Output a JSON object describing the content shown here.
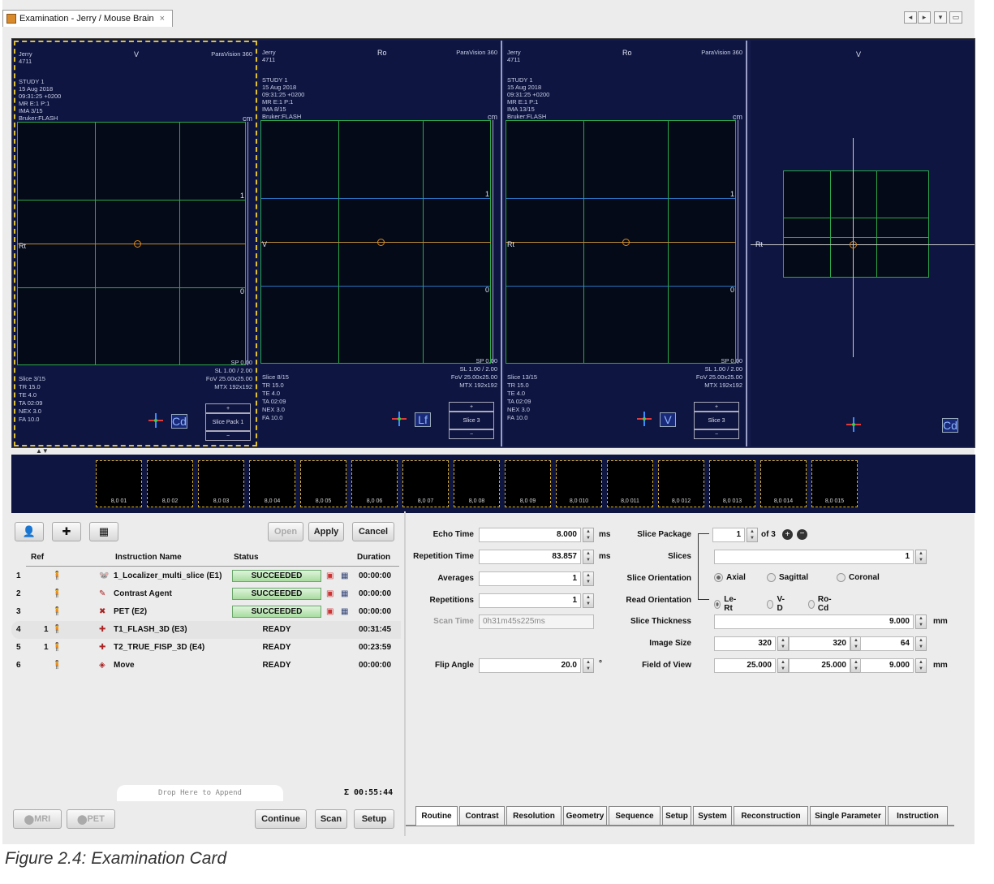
{
  "window": {
    "tab_title": "Examination - Jerry / Mouse Brain",
    "tab_close": "×"
  },
  "title_buttons": [
    "◂",
    "▸",
    "▾",
    "▭"
  ],
  "viewports": [
    {
      "orientation": "V",
      "software": "ParaVision 360",
      "patient": "Jerry",
      "id": "4711",
      "study": "STUDY 1",
      "date": "15 Aug 2018",
      "time": "09:31:25 +0200",
      "series": "MR E:1 P:1",
      "image": "IMA 3/15",
      "seq": "Bruker:FLASH",
      "unit": "cm",
      "tick_top": "1",
      "tick_bot": "0",
      "left_label": "Rt",
      "sp": "SP 0.00",
      "sl": "SL 1.00 / 2.00",
      "fov": "FoV 25.00x25.00",
      "mtx": "MTX 192x192",
      "slice": "Slice 3/15",
      "tr": "TR 15.0",
      "te": "TE 4.0",
      "ta": "TA 02:09",
      "nex": "NEX 3.0",
      "fa": "FA 10.0",
      "badge": "Cd",
      "pack": "Slice Pack 1",
      "plus": "+",
      "minus": "−"
    },
    {
      "orientation": "Ro",
      "software": "ParaVision 360",
      "patient": "Jerry",
      "id": "4711",
      "study": "STUDY 1",
      "date": "15 Aug 2018",
      "time": "09:31:25 +0200",
      "series": "MR E:1 P:1",
      "image": "IMA 8/15",
      "seq": "Bruker:FLASH",
      "unit": "cm",
      "tick_top": "1",
      "tick_bot": "0",
      "left_label": "V",
      "sp": "SP 0.00",
      "sl": "SL 1.00 / 2.00",
      "fov": "FoV 25.00x25.00",
      "mtx": "MTX 192x192",
      "slice": "Slice 8/15",
      "tr": "TR 15.0",
      "te": "TE 4.0",
      "ta": "TA 02:09",
      "nex": "NEX 3.0",
      "fa": "FA 10.0",
      "badge": "Lf",
      "pack": "Slice 3",
      "plus": "+",
      "minus": "−"
    },
    {
      "orientation": "Ro",
      "software": "ParaVision 360",
      "patient": "Jerry",
      "id": "4711",
      "study": "STUDY 1",
      "date": "15 Aug 2018",
      "time": "09:31:25 +0200",
      "series": "MR E:1 P:1",
      "image": "IMA 13/15",
      "seq": "Bruker:FLASH",
      "unit": "cm",
      "tick_top": "1",
      "tick_bot": "0",
      "left_label": "Rt",
      "sp": "SP 0.00",
      "sl": "SL 1.00 / 2.00",
      "fov": "FoV 25.00x25.00",
      "mtx": "MTX 192x192",
      "slice": "Slice 13/15",
      "tr": "TR 15.0",
      "te": "TE 4.0",
      "ta": "TA 02:09",
      "nex": "NEX 3.0",
      "fa": "FA 10.0",
      "badge": "V",
      "pack": "Slice 3",
      "plus": "+",
      "minus": "−"
    }
  ],
  "viewport4": {
    "orientation": "V",
    "left_label": "Rt",
    "badge": "Cd"
  },
  "thumbnails": [
    "8,0 01",
    "8,0 02",
    "8,0 03",
    "8,0 04",
    "8,0 05",
    "8,0 06",
    "8,0 07",
    "8,0 08",
    "8,0 09",
    "8,0 010",
    "8,0 011",
    "8,0 012",
    "8,0 013",
    "8,0 014",
    "8,0 015"
  ],
  "toolbar": {
    "open": "Open",
    "apply": "Apply",
    "cancel": "Cancel"
  },
  "table": {
    "headers": {
      "ref": "Ref",
      "name": "Instruction Name",
      "status": "Status",
      "duration": "Duration"
    },
    "rows": [
      {
        "num": "1",
        "ref": "",
        "name": "1_Localizer_multi_slice (E1)",
        "status": "SUCCEEDED",
        "duration": "00:00:00",
        "done": true
      },
      {
        "num": "2",
        "ref": "",
        "name": "Contrast Agent",
        "status": "SUCCEEDED",
        "duration": "00:00:00",
        "done": true
      },
      {
        "num": "3",
        "ref": "",
        "name": "PET (E2)",
        "status": "SUCCEEDED",
        "duration": "00:00:00",
        "done": true
      },
      {
        "num": "4",
        "ref": "1",
        "name": "T1_FLASH_3D (E3)",
        "status": "READY",
        "duration": "00:31:45",
        "done": false
      },
      {
        "num": "5",
        "ref": "1",
        "name": "T2_TRUE_FISP_3D (E4)",
        "status": "READY",
        "duration": "00:23:59",
        "done": false
      },
      {
        "num": "6",
        "ref": "",
        "name": "Move",
        "status": "READY",
        "duration": "00:00:00",
        "done": false
      }
    ]
  },
  "drop_hint": "Drop Here to Append",
  "total": "Σ 00:55:44",
  "bottom_left": {
    "mri": "MRI",
    "pet": "PET",
    "continue": "Continue",
    "scan": "Scan",
    "setup": "Setup"
  },
  "params": {
    "echo_time": {
      "label": "Echo Time",
      "value": "8.000",
      "unit": "ms"
    },
    "repetition_time": {
      "label": "Repetition Time",
      "value": "83.857",
      "unit": "ms"
    },
    "averages": {
      "label": "Averages",
      "value": "1"
    },
    "repetitions": {
      "label": "Repetitions",
      "value": "1"
    },
    "scan_time": {
      "label": "Scan Time",
      "value": "0h31m45s225ms"
    },
    "flip_angle": {
      "label": "Flip Angle",
      "value": "20.0",
      "unit": "°"
    },
    "slice_package": {
      "label": "Slice Package",
      "value": "1",
      "of": "of 3"
    },
    "slices": {
      "label": "Slices",
      "value": "1"
    },
    "slice_orientation": {
      "label": "Slice Orientation",
      "options": [
        "Axial",
        "Sagittal",
        "Coronal"
      ],
      "selected": "Axial"
    },
    "read_orientation": {
      "label": "Read Orientation",
      "options": [
        "Le-Rt",
        "V-D",
        "Ro-Cd"
      ],
      "selected": "Le-Rt"
    },
    "slice_thickness": {
      "label": "Slice Thickness",
      "value": "9.000",
      "unit": "mm"
    },
    "image_size": {
      "label": "Image Size",
      "values": [
        "320",
        "320",
        "64"
      ]
    },
    "field_of_view": {
      "label": "Field of View",
      "values": [
        "25.000",
        "25.000",
        "9.000"
      ],
      "unit": "mm"
    }
  },
  "param_tabs": [
    "Routine",
    "Contrast",
    "Resolution",
    "Geometry",
    "Sequence",
    "Setup",
    "System",
    "Reconstruction",
    "Single Parameter",
    "Instruction"
  ],
  "caption": "Figure 2.4: Examination Card"
}
